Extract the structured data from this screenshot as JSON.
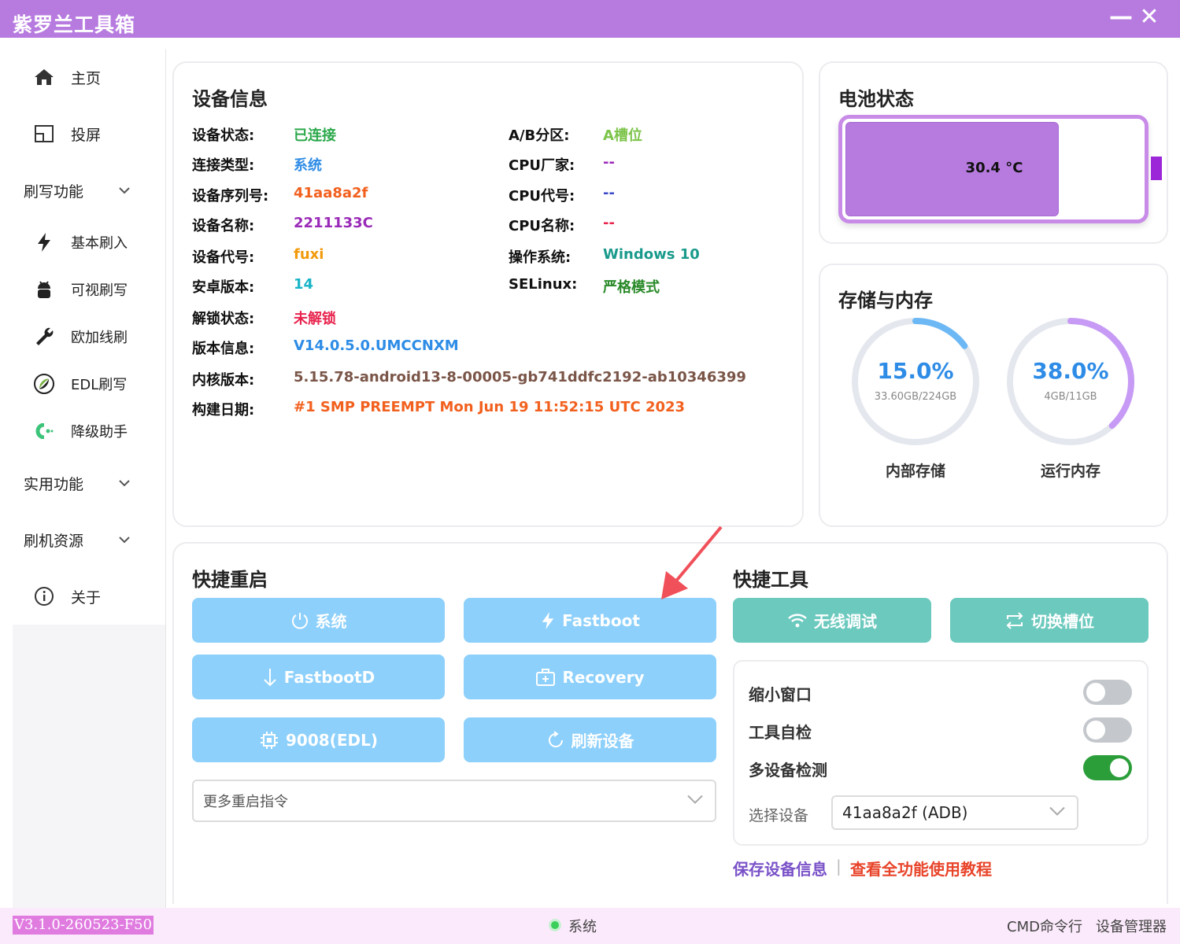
{
  "app": {
    "title": "紫罗兰工具箱",
    "minimize": "—",
    "close": "✕"
  },
  "sidebar": {
    "home": "主页",
    "cast": "投屏",
    "flash_group": "刷写功能",
    "basic_flash": "基本刷入",
    "visual_flash": "可视刷写",
    "oplus_flash": "欧加线刷",
    "edl_flash": "EDL刷写",
    "downgrade": "降级助手",
    "utility_group": "实用功能",
    "resources_group": "刷机资源",
    "about": "关于"
  },
  "device_info": {
    "title": "设备信息",
    "left": [
      {
        "key": "设备状态:",
        "value": "已连接",
        "color": "#2aa84a"
      },
      {
        "key": "连接类型:",
        "value": "系统",
        "color": "#2e8ce6"
      },
      {
        "key": "设备序列号:",
        "value": "41aa8a2f",
        "color": "#f2601e"
      },
      {
        "key": "设备名称:",
        "value": "2211133C",
        "color": "#9a2ab8"
      },
      {
        "key": "设备代号:",
        "value": "fuxi",
        "color": "#f29a0a"
      },
      {
        "key": "安卓版本:",
        "value": "14",
        "color": "#19b4c8"
      },
      {
        "key": "解锁状态:",
        "value": "未解锁",
        "color": "#e8244e"
      },
      {
        "key": "版本信息:",
        "value": "V14.0.5.0.UMCCNXM",
        "color": "#2e8ce6"
      },
      {
        "key": "内核版本:",
        "value": "5.15.78-android13-8-00005-gb741ddfc2192-ab10346399",
        "color": "#7a5548"
      },
      {
        "key": "构建日期:",
        "value": "#1 SMP PREEMPT Mon Jun 19 11:52:15 UTC 2023",
        "color": "#f2601e"
      }
    ],
    "right": [
      {
        "key": "A/B分区:",
        "value": "A槽位",
        "color": "#7cc44a"
      },
      {
        "key": "CPU厂家:",
        "value": "--",
        "color": "#9a2ab8"
      },
      {
        "key": "CPU代号:",
        "value": "--",
        "color": "#3a48c8"
      },
      {
        "key": "CPU名称:",
        "value": "--",
        "color": "#e8244e"
      },
      {
        "key": "操作系统:",
        "value": "Windows 10",
        "color": "#1a9a8c"
      },
      {
        "key": "SELinux:",
        "value": "严格模式",
        "color": "#2a8a2a"
      }
    ]
  },
  "battery": {
    "title": "电池状态",
    "temperature": "30.4 °C",
    "fill_fraction": 0.705
  },
  "storage": {
    "title": "存储与内存",
    "internal": {
      "percent": "15.0%",
      "fraction": 0.15,
      "detail": "33.60GB/224GB",
      "label": "内部存储",
      "color": "#6cb8f5"
    },
    "ram": {
      "percent": "38.0%",
      "fraction": 0.38,
      "detail": "4GB/11GB",
      "label": "运行内存",
      "color": "#c79bf5"
    }
  },
  "quick_reboot": {
    "title": "快捷重启",
    "system": "系统",
    "fastboot": "Fastboot",
    "fastbootd": "FastbootD",
    "recovery": "Recovery",
    "edl": "9008(EDL)",
    "refresh": "刷新设备",
    "more_placeholder": "更多重启指令"
  },
  "quick_tools": {
    "title": "快捷工具",
    "wireless_debug": "无线调试",
    "switch_slot": "切换槽位",
    "shrink_window": "缩小窗口",
    "self_check": "工具自检",
    "multi_device": "多设备检测",
    "shrink_on": false,
    "self_check_on": false,
    "multi_device_on": true,
    "select_label": "选择设备",
    "selected_device": "41aa8a2f (ADB)",
    "save_info": "保存设备信息",
    "separator": "|",
    "tutorial": "查看全功能使用教程"
  },
  "statusbar": {
    "version": "V3.1.0-260523-F50",
    "mode": "系统",
    "cmd": "CMD命令行",
    "device_manager": "设备管理器"
  },
  "colors": {
    "accent": "#b77be0",
    "button_blue": "#8dd0fb",
    "button_teal": "#6cc9be",
    "arrow": "#f0505a"
  }
}
